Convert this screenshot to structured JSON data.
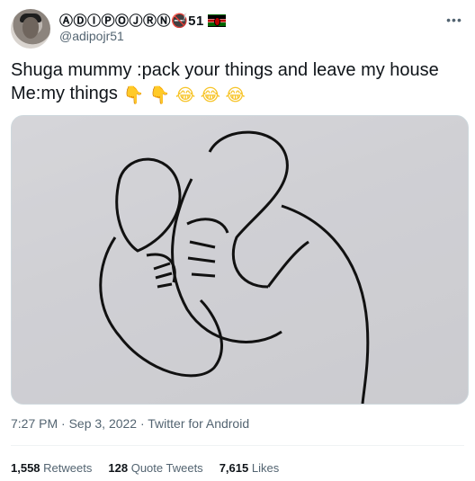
{
  "tweet": {
    "display_name": "ⒶⒹⒾⓅⓄⒿⓇⓃ🚭51",
    "handle": "@adipojr51",
    "text_line1": "Shuga mummy :pack your things and leave my house",
    "text_line2": "Me:my things",
    "text_emojis": [
      "👇",
      "👇",
      "😂",
      "😂",
      "😂"
    ],
    "meta": "7:27 PM · Sep 3, 2022 · Twitter for Android",
    "stats": {
      "retweets_count": "1,558",
      "retweets_label": "Retweets",
      "quote_count": "128",
      "quote_label": "Quote Tweets",
      "likes_count": "7,615",
      "likes_label": "Likes"
    }
  },
  "icons": {
    "more": "more-icon",
    "flag": "kenya-flag-icon"
  }
}
